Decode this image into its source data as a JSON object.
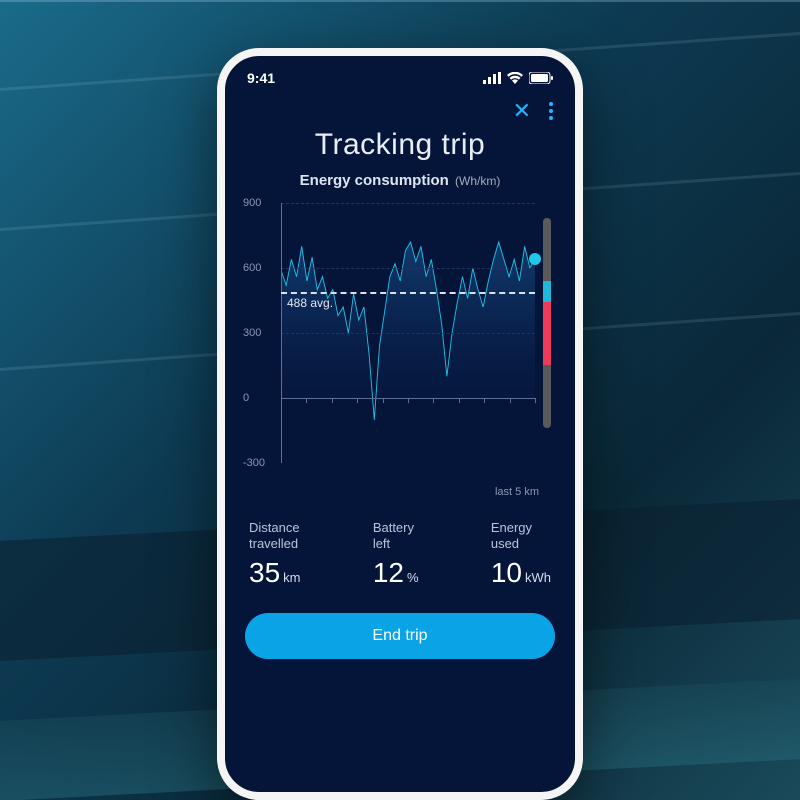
{
  "status_bar": {
    "time": "9:41"
  },
  "header": {
    "title": "Tracking trip",
    "subtitle": "Energy consumption",
    "subtitle_unit": "(Wh/km)"
  },
  "chart": {
    "x_note": "last 5 km",
    "avg_label": "488 avg.",
    "y_ticks": {
      "t900": "900",
      "t600": "600",
      "t300": "300",
      "t0": "0",
      "tm300": "-300"
    }
  },
  "gauge": {
    "cyan_pct": 10,
    "red_pct": 30
  },
  "stats": {
    "distance": {
      "label1": "Distance",
      "label2": "travelled",
      "value": "35",
      "unit": "km"
    },
    "battery": {
      "label1": "Battery",
      "label2": "left",
      "value": "12",
      "unit": "%"
    },
    "energy": {
      "label1": "Energy",
      "label2": "used",
      "value": "10",
      "unit": "kWh"
    }
  },
  "actions": {
    "end_trip": "End trip"
  },
  "chart_data": {
    "type": "line",
    "title": "Energy consumption (Wh/km)",
    "xlabel": "last 5 km",
    "ylabel": "Wh/km",
    "ylim": [
      -300,
      900
    ],
    "y_ticks": [
      -300,
      0,
      300,
      600,
      900
    ],
    "avg": 488,
    "x": [
      0,
      1,
      2,
      3,
      4,
      5,
      6,
      7,
      8,
      9,
      10,
      11,
      12,
      13,
      14,
      15,
      16,
      17,
      18,
      19,
      20,
      21,
      22,
      23,
      24,
      25,
      26,
      27,
      28,
      29,
      30,
      31,
      32,
      33,
      34,
      35,
      36,
      37,
      38,
      39,
      40,
      41,
      42,
      43,
      44,
      45,
      46,
      47,
      48,
      49
    ],
    "values": [
      590,
      520,
      640,
      560,
      700,
      540,
      650,
      500,
      560,
      460,
      500,
      380,
      420,
      300,
      480,
      360,
      420,
      200,
      -100,
      240,
      400,
      560,
      620,
      540,
      680,
      720,
      630,
      700,
      560,
      640,
      500,
      340,
      100,
      300,
      440,
      560,
      460,
      600,
      500,
      420,
      540,
      640,
      720,
      640,
      560,
      640,
      540,
      700,
      600,
      640
    ],
    "marker": {
      "x": 49,
      "y": 640
    }
  }
}
